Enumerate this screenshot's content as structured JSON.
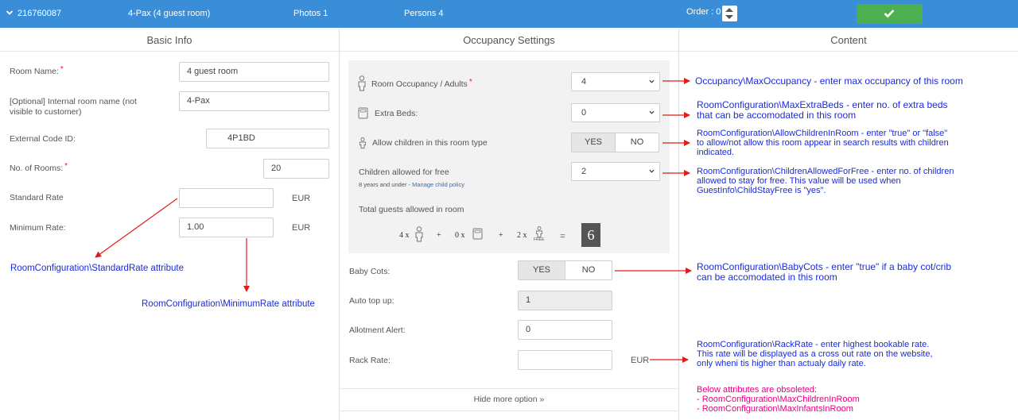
{
  "header": {
    "room_id": "216760087",
    "room_title": "4-Pax (4 guest room)",
    "photos": "Photos 1",
    "persons": "Persons 4",
    "order_label": "Order : 0"
  },
  "columns": {
    "basic_info": "Basic Info",
    "occupancy": "Occupancy Settings",
    "content": "Content"
  },
  "basic": {
    "room_name_label": "Room Name:",
    "room_name_value": "4 guest room",
    "internal_name_label_1": "[Optional] Internal room name (not",
    "internal_name_label_2": "visible to customer)",
    "internal_name_value": "4-Pax",
    "external_code_label": "External Code ID:",
    "external_code_value": "4P1BD",
    "no_rooms_label": "No. of Rooms:",
    "no_rooms_value": "20",
    "standard_rate_label": "Standard Rate",
    "standard_rate_value": "",
    "standard_rate_unit": "EUR",
    "minimum_rate_label": "Minimum Rate:",
    "minimum_rate_value": "1.00",
    "minimum_rate_unit": "EUR",
    "required_mark": "*"
  },
  "occupancy": {
    "adults_label": "Room Occupancy / Adults",
    "adults_value": "4",
    "extra_beds_label": "Extra Beds:",
    "extra_beds_value": "0",
    "allow_children_label": "Allow children in this room type",
    "yes": "YES",
    "no": "NO",
    "children_free_label": "Children allowed for free",
    "children_free_value": "2",
    "children_free_hint": "8 years and under - ",
    "manage_child_policy": "Manage child policy",
    "total_guests_label": "Total guests allowed in room",
    "formula_adults": "4 x",
    "formula_beds": "0 x",
    "formula_children": "2 x",
    "plus": "+",
    "equals": "=",
    "total": "6",
    "free_tag": "FREE",
    "baby_cots_label": "Baby Cots:",
    "auto_top_up_label": "Auto top up:",
    "auto_top_up_value": "1",
    "allotment_alert_label": "Allotment Alert:",
    "allotment_alert_value": "0",
    "rack_rate_label": "Rack Rate:",
    "rack_rate_value": "",
    "rack_rate_unit": "EUR",
    "hide_more": "Hide more option »"
  },
  "notes": {
    "max_occupancy": "Occupancy\\MaxOccupancy - enter max occupancy of this room",
    "extra_beds_1": "RoomConfiguration\\MaxExtraBeds - enter no. of extra beds",
    "extra_beds_2": "that can be accomodated in this room",
    "allow_children_1": "RoomConfiguration\\AllowChildrenInRoom - enter \"true\" or \"false\"",
    "allow_children_2": "to allow/not allow this room appear in search results with children",
    "allow_children_3": "indicated.",
    "children_free_1": "RoomConfiguration\\ChildrenAllowedForFree - enter no. of children",
    "children_free_2": "allowed to stay for free. This value will be used when",
    "children_free_3": "GuestInfo\\ChildStayFree is \"yes\".",
    "baby_cots_1": "RoomConfiguration\\BabyCots - enter \"true\" if a baby cot/crib",
    "baby_cots_2": "can be accomodated in this room",
    "rack_rate_1": "RoomConfiguration\\RackRate - enter highest bookable rate.",
    "rack_rate_2": "This rate will be displayed as a cross out rate on the website,",
    "rack_rate_3": "only wheni tis higher than actualy daily rate.",
    "obsolete_1": "Below attributes are obsoleted:",
    "obsolete_2": "- RoomConfiguration\\MaxChildrenInRoom",
    "obsolete_3": "- RoomConfiguration\\MaxInfantsInRoom",
    "standard_rate": "RoomConfiguration\\StandardRate attribute",
    "minimum_rate": "RoomConfiguration\\MinimumRate attribute"
  },
  "colors": {
    "header_bg": "#3a8ed8",
    "save_green": "#4caf50",
    "note_blue": "#1b2bdc",
    "note_pink": "#e6007e",
    "arrow_red": "#e01b1b"
  },
  "icons": {
    "collapse": "chevron-down-icon",
    "save": "checkmark-icon",
    "adult": "person-icon",
    "bed": "bed-icon",
    "child": "child-icon"
  }
}
